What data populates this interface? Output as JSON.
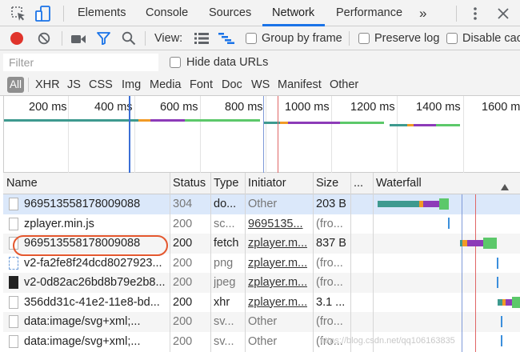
{
  "tabs": [
    {
      "label": "Elements"
    },
    {
      "label": "Console"
    },
    {
      "label": "Sources"
    },
    {
      "label": "Network"
    },
    {
      "label": "Performance"
    },
    {
      "label": "»"
    }
  ],
  "toolbar": {
    "view_label": "View:",
    "group_by_frame": "Group by frame",
    "preserve_log": "Preserve log",
    "disable_cache": "Disable cac"
  },
  "filter": {
    "placeholder": "Filter",
    "hide_data_urls": "Hide data URLs"
  },
  "types": [
    "All",
    "XHR",
    "JS",
    "CSS",
    "Img",
    "Media",
    "Font",
    "Doc",
    "WS",
    "Manifest",
    "Other"
  ],
  "overview": {
    "ticks": [
      "200 ms",
      "400 ms",
      "600 ms",
      "800 ms",
      "1000 ms",
      "1200 ms",
      "1400 ms",
      "1600 m"
    ]
  },
  "table": {
    "headers": {
      "name": "Name",
      "status": "Status",
      "type": "Type",
      "initiator": "Initiator",
      "size": "Size",
      "more": "...",
      "waterfall": "Waterfall"
    },
    "rows": [
      {
        "name": "969513558178009088",
        "status": "304",
        "type": "do...",
        "initiator": "Other",
        "size": "203 B",
        "icon": "document-icon"
      },
      {
        "name": "zplayer.min.js",
        "status": "200",
        "type": "sc...",
        "initiator": "9695135...",
        "size": "(fro...",
        "icon": "document-icon"
      },
      {
        "name": "969513558178009088",
        "status": "200",
        "type": "fetch",
        "initiator": "zplayer.m...",
        "size": "837 B",
        "icon": "document-icon"
      },
      {
        "name": "v2-fa2fe8f24dcd8027923...",
        "status": "200",
        "type": "png",
        "initiator": "zplayer.m...",
        "size": "(fro...",
        "icon": "image-icon"
      },
      {
        "name": "v2-0d82ac26bd8b79e2b8...",
        "status": "200",
        "type": "jpeg",
        "initiator": "zplayer.m...",
        "size": "(fro...",
        "icon": "image-thumbnail-icon"
      },
      {
        "name": "356dd31c-41e2-11e8-bd...",
        "status": "200",
        "type": "xhr",
        "initiator": "zplayer.m...",
        "size": "3.1 ...",
        "icon": "document-icon"
      },
      {
        "name": "data:image/svg+xml;...",
        "status": "200",
        "type": "sv...",
        "initiator": "Other",
        "size": "(fro...",
        "icon": "document-icon"
      },
      {
        "name": "data:image/svg+xml;...",
        "status": "200",
        "type": "sv...",
        "initiator": "Other",
        "size": "(fro...",
        "icon": "document-icon"
      }
    ]
  },
  "watermark": "https://blog.csdn.net/qq106163835",
  "colors": {
    "record": "#e0342b",
    "filter_active": "#1a73e8",
    "waterfall_teal": "#3e9a8f",
    "waterfall_green": "#5cc86a",
    "waterfall_purple": "#8d3bb8",
    "waterfall_orange": "#f19a26",
    "selected_row": "#dbe8fa",
    "annotation": "#e4572e"
  }
}
